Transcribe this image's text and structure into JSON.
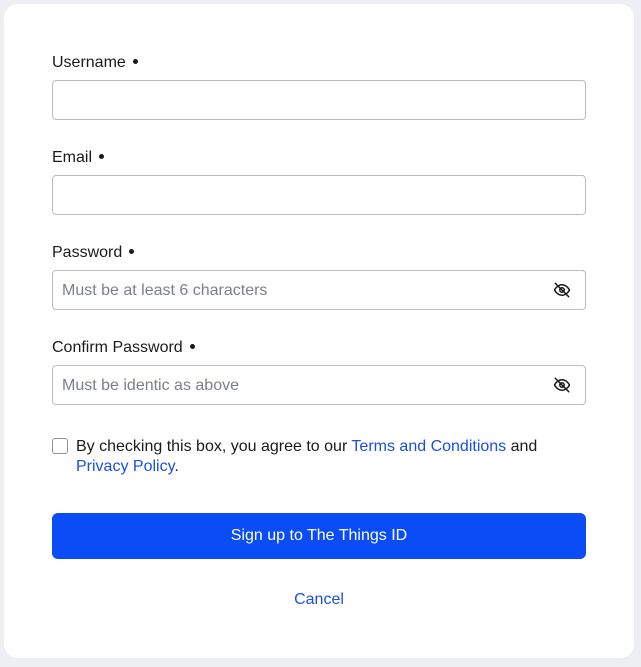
{
  "form": {
    "username": {
      "label": "Username",
      "value": "",
      "placeholder": ""
    },
    "email": {
      "label": "Email",
      "value": "",
      "placeholder": ""
    },
    "password": {
      "label": "Password",
      "value": "",
      "placeholder": "Must be at least 6 characters",
      "toggle_icon": "eye-off-icon"
    },
    "confirm_password": {
      "label": "Confirm Password",
      "value": "",
      "placeholder": "Must be identic as above",
      "toggle_icon": "eye-off-icon"
    },
    "consent": {
      "checked": false,
      "text_before": "By checking this box, you agree to our ",
      "terms_link": "Terms and Conditions",
      "text_middle": " and",
      "privacy_link": "Privacy Policy",
      "text_after": "."
    },
    "submit_label": "Sign up to The Things ID",
    "cancel_label": "Cancel"
  },
  "colors": {
    "primary": "#0a4cf5",
    "link": "#1a4fe0",
    "background": "#eeeff2"
  }
}
